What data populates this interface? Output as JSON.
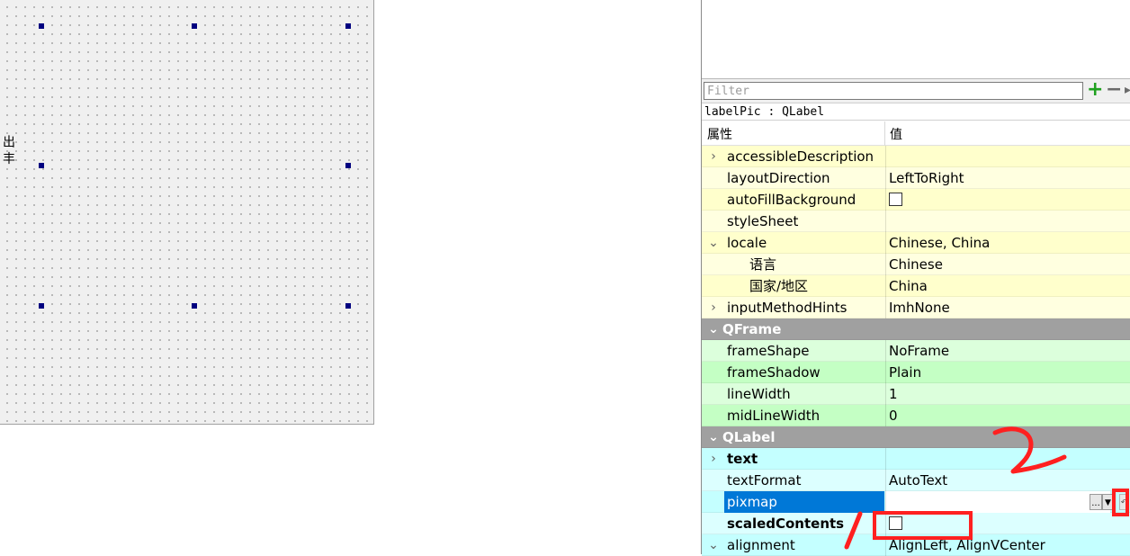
{
  "canvas": {
    "vertical_label": "出 丰"
  },
  "property_editor": {
    "filter_placeholder": "Filter",
    "add_icon": "plus-icon",
    "remove_icon": "minus-icon",
    "object_label": "labelPic : QLabel",
    "header": {
      "property": "属性",
      "value": "值"
    },
    "rows": {
      "accessibleDescription": {
        "name": "accessibleDescription",
        "value": ""
      },
      "layoutDirection": {
        "name": "layoutDirection",
        "value": "LeftToRight"
      },
      "autoFillBackground": {
        "name": "autoFillBackground",
        "checked": false
      },
      "styleSheet": {
        "name": "styleSheet",
        "value": ""
      },
      "locale": {
        "name": "locale",
        "value": "Chinese, China"
      },
      "language": {
        "name": "语言",
        "value": "Chinese"
      },
      "country": {
        "name": "国家/地区",
        "value": "China"
      },
      "inputMethodHints": {
        "name": "inputMethodHints",
        "value": "ImhNone"
      },
      "qframe_group": {
        "name": "QFrame"
      },
      "frameShape": {
        "name": "frameShape",
        "value": "NoFrame"
      },
      "frameShadow": {
        "name": "frameShadow",
        "value": "Plain"
      },
      "lineWidth": {
        "name": "lineWidth",
        "value": "1"
      },
      "midLineWidth": {
        "name": "midLineWidth",
        "value": "0"
      },
      "qlabel_group": {
        "name": "QLabel"
      },
      "text": {
        "name": "text",
        "value": ""
      },
      "textFormat": {
        "name": "textFormat",
        "value": "AutoText"
      },
      "pixmap": {
        "name": "pixmap",
        "value": "",
        "browse": "..."
      },
      "scaledContents": {
        "name": "scaledContents",
        "checked": false
      },
      "alignment": {
        "name": "alignment",
        "value": "AlignLeft, AlignVCenter"
      }
    }
  },
  "colors": {
    "annotation": "#ff2020",
    "selection": "#0078d7",
    "qobject_rows": "#ffffcc",
    "qframe_rows": "#c4ffc4",
    "qlabel_rows": "#c4ffff",
    "group_header": "#a0a0a0"
  }
}
